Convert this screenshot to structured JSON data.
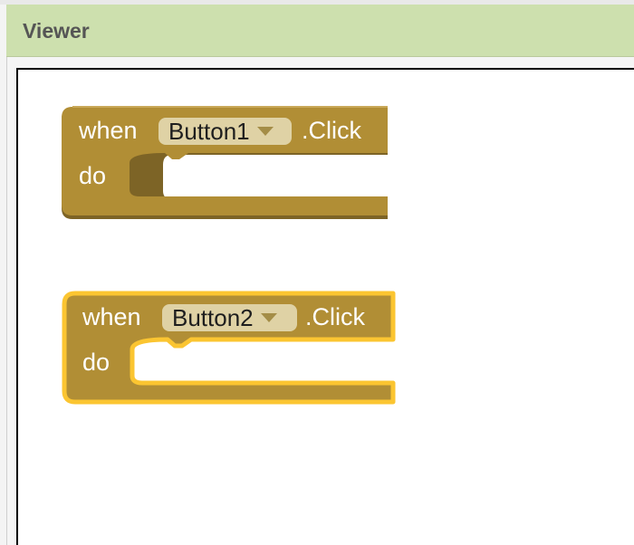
{
  "viewer": {
    "title": "Viewer"
  },
  "blocks": [
    {
      "when_label": "when",
      "component": "Button1",
      "event": ".Click",
      "do_label": "do",
      "selected": false
    },
    {
      "when_label": "when",
      "component": "Button2",
      "event": ".Click",
      "do_label": "do",
      "selected": true
    }
  ],
  "colors": {
    "block_fill": "#b18e35",
    "block_shadow": "#7d6426",
    "selection_highlight": "#fbc531",
    "dropdown_fill": "#dfd2a5",
    "header_bg": "#cde0ae"
  }
}
